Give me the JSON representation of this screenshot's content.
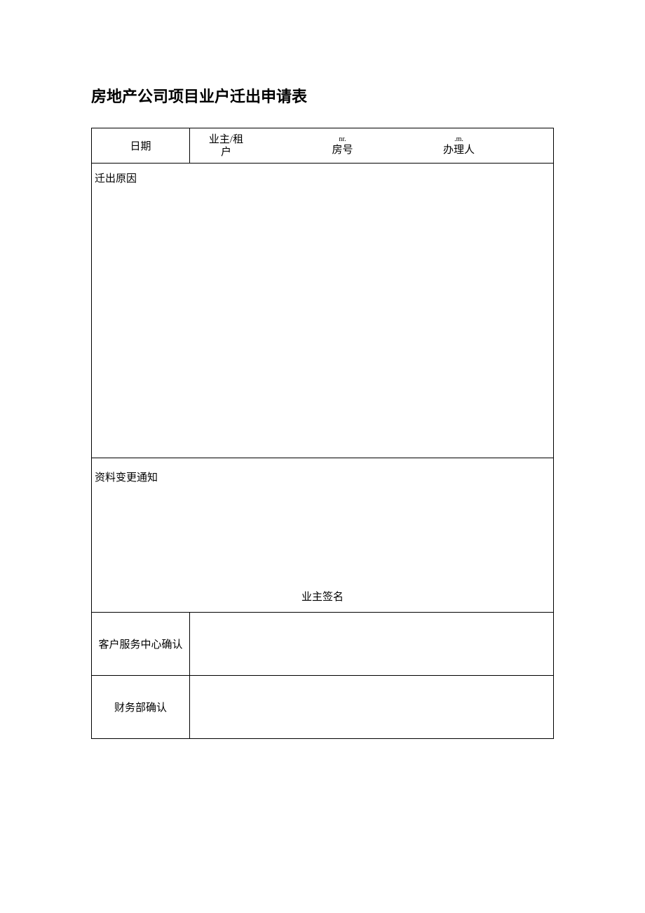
{
  "title": "房地产公司项目业户迁出申请表",
  "header": {
    "date": "日期",
    "owner_tenant_line1": "业主/租",
    "owner_tenant_line2": "户",
    "room_small": "nr.",
    "room": "房号",
    "handler_small": ".m.",
    "handler": "办理人"
  },
  "rows": {
    "reason": "迁出原因",
    "notice": "资料变更通知",
    "owner_signature": "业主签名",
    "service_confirm": "客户服务中心确认",
    "finance_confirm": "财务部确认"
  }
}
